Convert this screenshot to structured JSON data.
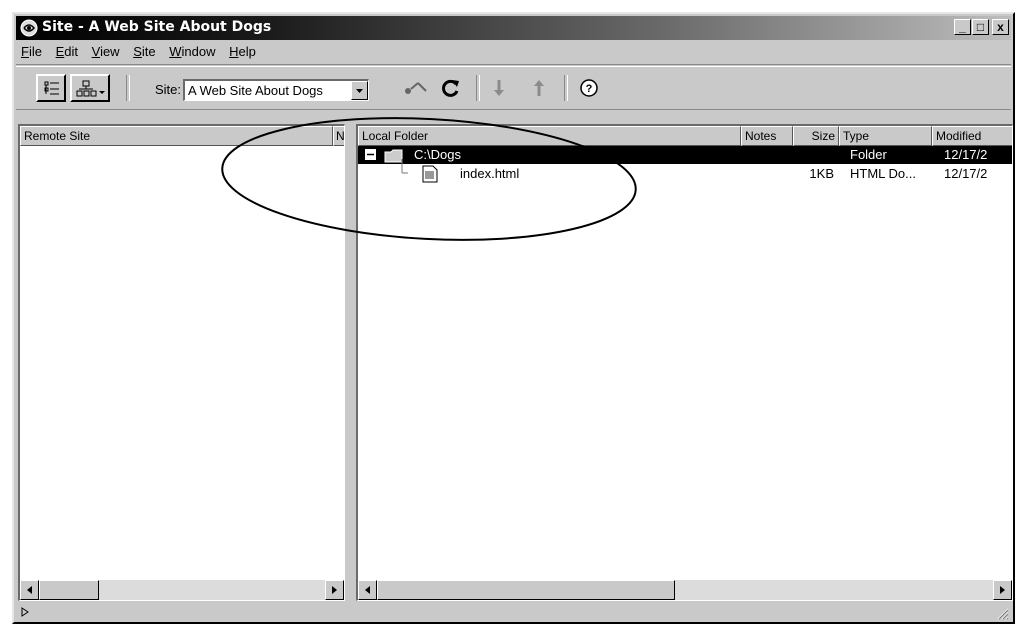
{
  "window": {
    "title": "Site - A Web Site About Dogs",
    "controls": {
      "minimize": "_",
      "maximize": "□",
      "close": "x"
    }
  },
  "menu": [
    {
      "accel": "F",
      "rest": "ile"
    },
    {
      "accel": "E",
      "rest": "dit"
    },
    {
      "accel": "V",
      "rest": "iew"
    },
    {
      "accel": "S",
      "rest": "ite"
    },
    {
      "accel": "W",
      "rest": "indow"
    },
    {
      "accel": "H",
      "rest": "elp"
    }
  ],
  "toolbar": {
    "site_label": "Site:",
    "site_value": "A Web Site About Dogs",
    "icons": [
      "site-files-icon",
      "site-map-icon",
      "connect-icon",
      "refresh-icon",
      "get-icon",
      "put-icon",
      "help-icon"
    ]
  },
  "remote": {
    "header_name": "Remote Site",
    "header_next": "N"
  },
  "local": {
    "headers": {
      "name": "Local Folder",
      "notes": "Notes",
      "size": "Size",
      "type": "Type",
      "modified": "Modified"
    },
    "rows": [
      {
        "name": "C:\\Dogs",
        "notes": "",
        "size": "",
        "type": "Folder",
        "modified": "12/17/2",
        "selected": true
      },
      {
        "name": "index.html",
        "notes": "",
        "size": "1KB",
        "type": "HTML Do...",
        "modified": "12/17/2",
        "selected": false
      }
    ]
  },
  "status": {
    "text": ""
  },
  "colors": {
    "selection": "#000000",
    "chrome": "#c9c9c9",
    "annotation": "#000000"
  }
}
